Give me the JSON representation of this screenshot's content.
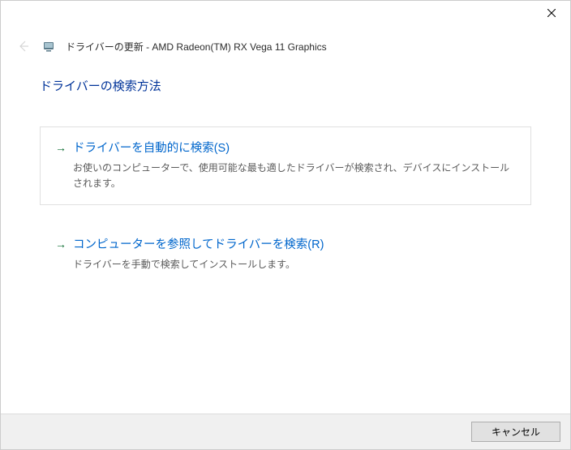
{
  "titlebar": {
    "close_label": "閉じる"
  },
  "header": {
    "title": "ドライバーの更新 - AMD Radeon(TM) RX Vega 11 Graphics"
  },
  "content": {
    "heading": "ドライバーの検索方法",
    "options": [
      {
        "title": "ドライバーを自動的に検索(S)",
        "desc": "お使いのコンピューターで、使用可能な最も適したドライバーが検索され、デバイスにインストールされます。"
      },
      {
        "title": "コンピューターを参照してドライバーを検索(R)",
        "desc": "ドライバーを手動で検索してインストールします。"
      }
    ]
  },
  "footer": {
    "cancel_label": "キャンセル"
  }
}
